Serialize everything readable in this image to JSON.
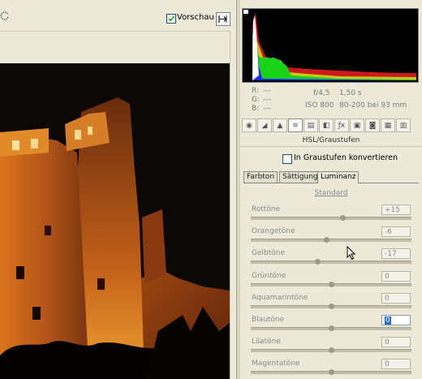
{
  "toolbar": {
    "preview_label": "Vorschau",
    "preview_checked": true
  },
  "readout": {
    "r_label": "R:",
    "r_value": "---",
    "g_label": "G:",
    "g_value": "---",
    "b_label": "B:",
    "b_value": "---",
    "aperture": "f/4,5",
    "shutter": "1,50 s",
    "iso": "ISO 800",
    "lens": "80-200 bei 93 mm"
  },
  "panel": {
    "title": "HSL/Graustufen",
    "grayscale_label": "In Graustufen konvertieren",
    "grayscale_checked": false,
    "tabs": [
      {
        "label": "Farbton",
        "active": false
      },
      {
        "label": "Sättigung",
        "active": false
      },
      {
        "label": "Luminanz",
        "active": true
      }
    ],
    "standard_link": "Standard",
    "sliders": [
      {
        "label": "Rottöne",
        "value": "+15",
        "level": 0.575
      },
      {
        "label": "Orangetöne",
        "value": "-6",
        "level": 0.47
      },
      {
        "label": "Gelbtöne",
        "value": "-17",
        "level": 0.415
      },
      {
        "label": "Grüntöne",
        "value": "0",
        "level": 0.5
      },
      {
        "label": "Aquamarintöne",
        "value": "0",
        "level": 0.5
      },
      {
        "label": "Blautöne",
        "value": "0",
        "level": 0.5
      },
      {
        "label": "Lilatöne",
        "value": "0",
        "level": 0.5
      },
      {
        "label": "Magentatöne",
        "value": "0",
        "level": 0.5
      }
    ]
  },
  "tab_icons": [
    "basic-icon",
    "tone-curve-icon",
    "detail-icon",
    "hsl-icon",
    "split-toning-icon",
    "lens-corrections-icon",
    "camera-calibration-icon",
    "fx-icon",
    "camera-icon",
    "presets-icon",
    "snapshots-icon"
  ],
  "colors": {
    "accent": "#316ac5",
    "panel_bg": "#ece9d8"
  }
}
